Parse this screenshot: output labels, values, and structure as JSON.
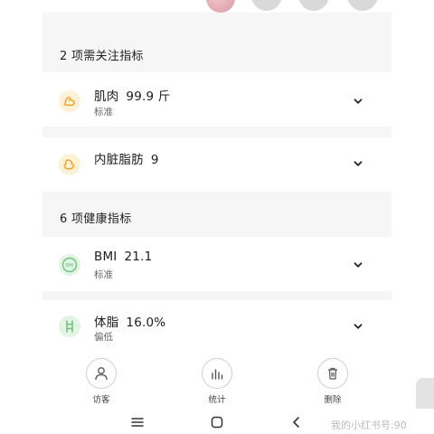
{
  "sections": {
    "attention": {
      "title": "2 项需关注指标"
    },
    "healthy": {
      "title": "6 项健康指标"
    }
  },
  "metrics": [
    {
      "name": "肌肉",
      "value": "99.9 斤",
      "status": "标准",
      "icon": "muscle-icon"
    },
    {
      "name": "内脏脂肪",
      "value": "9",
      "status": "",
      "icon": "visceral-fat-icon"
    },
    {
      "name": "BMI",
      "value": "21.1",
      "status": "标准",
      "icon": "bmi-icon"
    },
    {
      "name": "体脂",
      "value": "16.0%",
      "status": "偏低",
      "icon": "body-fat-icon"
    }
  ],
  "actions": [
    {
      "label": "访客",
      "icon": "person-icon"
    },
    {
      "label": "统计",
      "icon": "bar-chart-icon"
    },
    {
      "label": "删除",
      "icon": "trash-icon"
    }
  ],
  "colors": {
    "panel_bg": "#f6f6f6",
    "attention_icon_bg": "#fdf1d8",
    "attention_icon_fg": "#f0a830",
    "healthy_icon_bg": "#e2f4e3",
    "healthy_icon_fg": "#6ec07a"
  },
  "watermark": "我的小红书号:90"
}
